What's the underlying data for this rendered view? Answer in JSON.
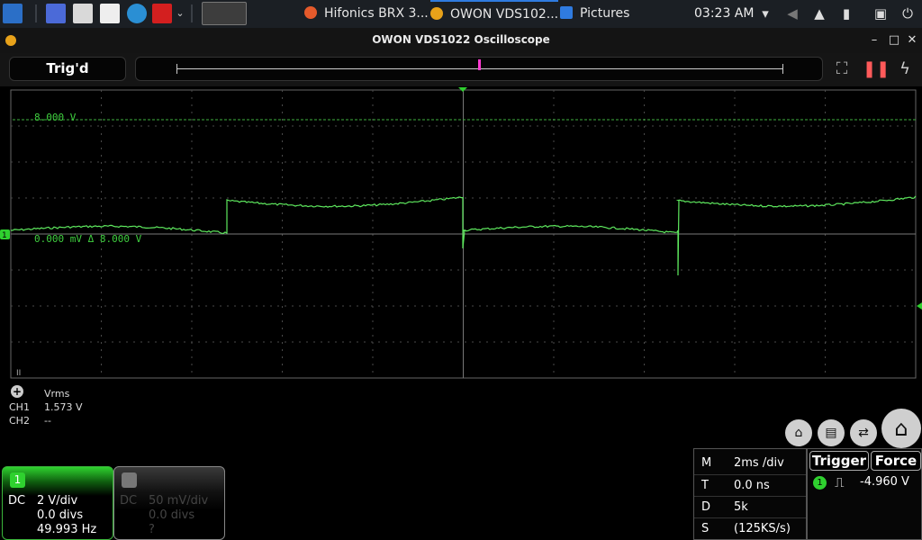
{
  "taskbar": {
    "tasks": [
      {
        "label": "Hifonics BRX 3...",
        "icon": "firefox-icon"
      },
      {
        "label": "OWON VDS102...",
        "icon": "owon-icon"
      },
      {
        "label": "Pictures",
        "icon": "folder-icon"
      }
    ],
    "clock": "03:23 AM",
    "tray_icons": [
      "wifi-icon",
      "volume-icon",
      "notification-bell-icon",
      "battery-icon",
      "lock-icon",
      "power-icon"
    ]
  },
  "window": {
    "title": "OWON VDS1022 Oscilloscope",
    "controls": {
      "minimize": "–",
      "maximize": "□",
      "close": "✕"
    }
  },
  "toolbar": {
    "trigger_state": "Trig'd"
  },
  "screen": {
    "ch1_level_label": "8.000 V",
    "ch1_cursor_label": "0.000 mV Δ 8.000 V",
    "ch1_marker": "1",
    "pause_marker": "II",
    "colors": {
      "trace": "#5ee85e",
      "grid": "#4a4a4a",
      "marker": "#2fd12f"
    }
  },
  "measure": {
    "header": "Vrms",
    "rows": [
      {
        "ch": "CH1",
        "value": "1.573 V"
      },
      {
        "ch": "CH2",
        "value": "--"
      }
    ]
  },
  "channels": [
    {
      "num": "1",
      "coupling": "DC",
      "volts_div": "2 V/div",
      "offset": "0.0 divs",
      "freq": "49.993 Hz",
      "active": true
    },
    {
      "num": "2",
      "coupling": "DC",
      "volts_div": "50 mV/div",
      "offset": "0.0 divs",
      "freq": "?",
      "active": false
    }
  ],
  "horizontal": {
    "rows": [
      {
        "k": "M",
        "v": "2ms /div"
      },
      {
        "k": "T",
        "v": "0.0 ns"
      },
      {
        "k": "D",
        "v": "5k"
      },
      {
        "k": "S",
        "v": "(125KS/s)"
      }
    ]
  },
  "trigger": {
    "trigger_label": "Trigger",
    "force_label": "Force",
    "source": "1",
    "level": "-4.960 V"
  }
}
